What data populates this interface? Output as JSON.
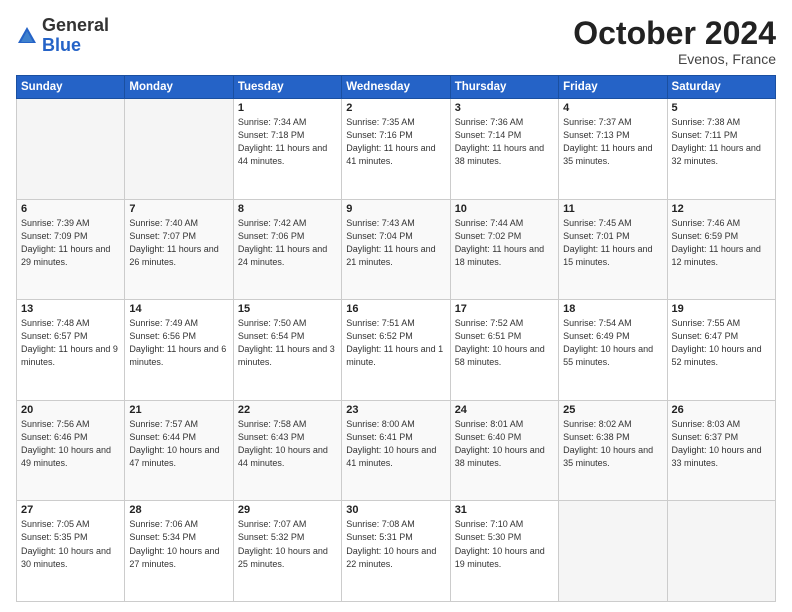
{
  "logo": {
    "general": "General",
    "blue": "Blue"
  },
  "header": {
    "month": "October 2024",
    "location": "Evenos, France"
  },
  "weekdays": [
    "Sunday",
    "Monday",
    "Tuesday",
    "Wednesday",
    "Thursday",
    "Friday",
    "Saturday"
  ],
  "weeks": [
    [
      {
        "day": "",
        "info": ""
      },
      {
        "day": "",
        "info": ""
      },
      {
        "day": "1",
        "info": "Sunrise: 7:34 AM\nSunset: 7:18 PM\nDaylight: 11 hours and 44 minutes."
      },
      {
        "day": "2",
        "info": "Sunrise: 7:35 AM\nSunset: 7:16 PM\nDaylight: 11 hours and 41 minutes."
      },
      {
        "day": "3",
        "info": "Sunrise: 7:36 AM\nSunset: 7:14 PM\nDaylight: 11 hours and 38 minutes."
      },
      {
        "day": "4",
        "info": "Sunrise: 7:37 AM\nSunset: 7:13 PM\nDaylight: 11 hours and 35 minutes."
      },
      {
        "day": "5",
        "info": "Sunrise: 7:38 AM\nSunset: 7:11 PM\nDaylight: 11 hours and 32 minutes."
      }
    ],
    [
      {
        "day": "6",
        "info": "Sunrise: 7:39 AM\nSunset: 7:09 PM\nDaylight: 11 hours and 29 minutes."
      },
      {
        "day": "7",
        "info": "Sunrise: 7:40 AM\nSunset: 7:07 PM\nDaylight: 11 hours and 26 minutes."
      },
      {
        "day": "8",
        "info": "Sunrise: 7:42 AM\nSunset: 7:06 PM\nDaylight: 11 hours and 24 minutes."
      },
      {
        "day": "9",
        "info": "Sunrise: 7:43 AM\nSunset: 7:04 PM\nDaylight: 11 hours and 21 minutes."
      },
      {
        "day": "10",
        "info": "Sunrise: 7:44 AM\nSunset: 7:02 PM\nDaylight: 11 hours and 18 minutes."
      },
      {
        "day": "11",
        "info": "Sunrise: 7:45 AM\nSunset: 7:01 PM\nDaylight: 11 hours and 15 minutes."
      },
      {
        "day": "12",
        "info": "Sunrise: 7:46 AM\nSunset: 6:59 PM\nDaylight: 11 hours and 12 minutes."
      }
    ],
    [
      {
        "day": "13",
        "info": "Sunrise: 7:48 AM\nSunset: 6:57 PM\nDaylight: 11 hours and 9 minutes."
      },
      {
        "day": "14",
        "info": "Sunrise: 7:49 AM\nSunset: 6:56 PM\nDaylight: 11 hours and 6 minutes."
      },
      {
        "day": "15",
        "info": "Sunrise: 7:50 AM\nSunset: 6:54 PM\nDaylight: 11 hours and 3 minutes."
      },
      {
        "day": "16",
        "info": "Sunrise: 7:51 AM\nSunset: 6:52 PM\nDaylight: 11 hours and 1 minute."
      },
      {
        "day": "17",
        "info": "Sunrise: 7:52 AM\nSunset: 6:51 PM\nDaylight: 10 hours and 58 minutes."
      },
      {
        "day": "18",
        "info": "Sunrise: 7:54 AM\nSunset: 6:49 PM\nDaylight: 10 hours and 55 minutes."
      },
      {
        "day": "19",
        "info": "Sunrise: 7:55 AM\nSunset: 6:47 PM\nDaylight: 10 hours and 52 minutes."
      }
    ],
    [
      {
        "day": "20",
        "info": "Sunrise: 7:56 AM\nSunset: 6:46 PM\nDaylight: 10 hours and 49 minutes."
      },
      {
        "day": "21",
        "info": "Sunrise: 7:57 AM\nSunset: 6:44 PM\nDaylight: 10 hours and 47 minutes."
      },
      {
        "day": "22",
        "info": "Sunrise: 7:58 AM\nSunset: 6:43 PM\nDaylight: 10 hours and 44 minutes."
      },
      {
        "day": "23",
        "info": "Sunrise: 8:00 AM\nSunset: 6:41 PM\nDaylight: 10 hours and 41 minutes."
      },
      {
        "day": "24",
        "info": "Sunrise: 8:01 AM\nSunset: 6:40 PM\nDaylight: 10 hours and 38 minutes."
      },
      {
        "day": "25",
        "info": "Sunrise: 8:02 AM\nSunset: 6:38 PM\nDaylight: 10 hours and 35 minutes."
      },
      {
        "day": "26",
        "info": "Sunrise: 8:03 AM\nSunset: 6:37 PM\nDaylight: 10 hours and 33 minutes."
      }
    ],
    [
      {
        "day": "27",
        "info": "Sunrise: 7:05 AM\nSunset: 5:35 PM\nDaylight: 10 hours and 30 minutes."
      },
      {
        "day": "28",
        "info": "Sunrise: 7:06 AM\nSunset: 5:34 PM\nDaylight: 10 hours and 27 minutes."
      },
      {
        "day": "29",
        "info": "Sunrise: 7:07 AM\nSunset: 5:32 PM\nDaylight: 10 hours and 25 minutes."
      },
      {
        "day": "30",
        "info": "Sunrise: 7:08 AM\nSunset: 5:31 PM\nDaylight: 10 hours and 22 minutes."
      },
      {
        "day": "31",
        "info": "Sunrise: 7:10 AM\nSunset: 5:30 PM\nDaylight: 10 hours and 19 minutes."
      },
      {
        "day": "",
        "info": ""
      },
      {
        "day": "",
        "info": ""
      }
    ]
  ]
}
